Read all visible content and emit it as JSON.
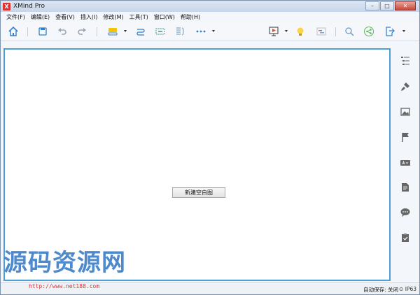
{
  "window": {
    "title": "XMind Pro",
    "logo_letter": "X",
    "controls": {
      "minimize": "–",
      "maximize": "□",
      "close": "✕"
    }
  },
  "menu": {
    "items": [
      "文件(F)",
      "编辑(E)",
      "查看(V)",
      "插入(I)",
      "修改(M)",
      "工具(T)",
      "窗口(W)",
      "帮助(H)"
    ]
  },
  "toolbar": {
    "icons": [
      "home-icon",
      "save-icon",
      "undo-icon",
      "redo-icon",
      "topic-style-icon",
      "relationship-icon",
      "boundary-icon",
      "summary-icon",
      "more-icon",
      "presentation-icon",
      "brainstorm-icon",
      "gantt-icon",
      "search-icon",
      "share-icon",
      "export-icon"
    ],
    "accent_color": "#2f7fd0"
  },
  "canvas": {
    "new_map_button": "新建空白图",
    "border_color": "#4d9fd6"
  },
  "side_panel": {
    "icons": [
      "outline-icon",
      "format-brush-icon",
      "image-icon",
      "marker-flag-icon",
      "label-icon",
      "notes-icon",
      "comments-icon",
      "task-icon"
    ]
  },
  "watermark": {
    "text": "源码资源网",
    "url": "http://www.net188.com"
  },
  "status": {
    "autosave": "自动保存: 关闭",
    "ip": "⊙ IP63"
  }
}
